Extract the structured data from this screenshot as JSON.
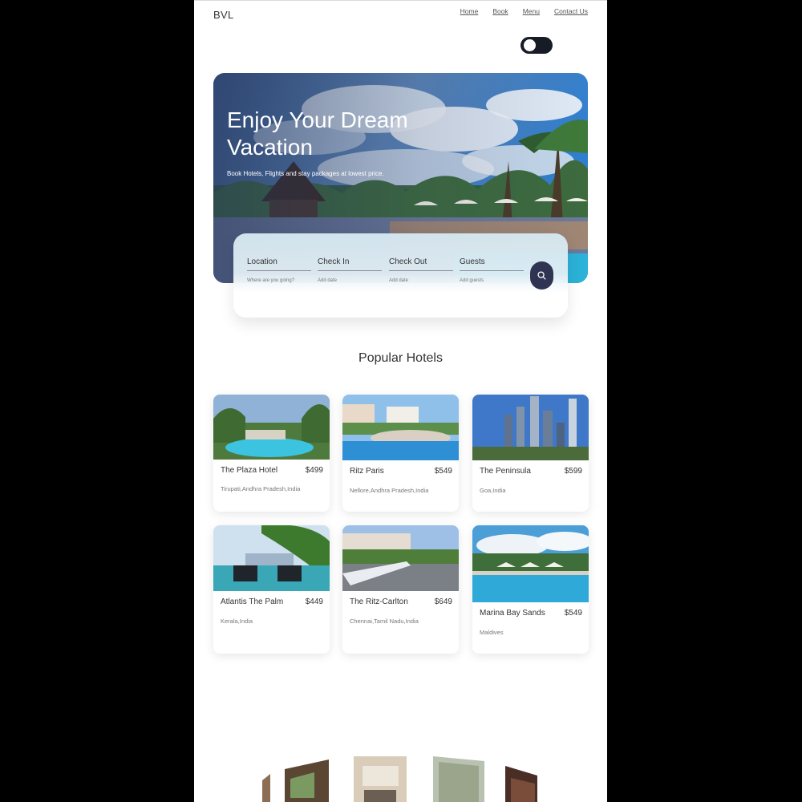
{
  "header": {
    "brand": "BVL",
    "nav": [
      "Home",
      "Book",
      "Menu",
      "Contact Us"
    ]
  },
  "theme_toggle": {
    "state": "off"
  },
  "hero": {
    "title": "Enjoy Your Dream Vacation",
    "subtitle": "Book Hotels, Flights and stay packages at lowest price."
  },
  "search": {
    "fields": [
      {
        "label": "Location",
        "placeholder": "Where are you going?"
      },
      {
        "label": "Check In",
        "placeholder": "Add date"
      },
      {
        "label": "Check Out",
        "placeholder": "Add date"
      },
      {
        "label": "Guests",
        "placeholder": "Add guests"
      }
    ],
    "button_icon": "search-icon"
  },
  "popular": {
    "title": "Popular Hotels",
    "hotels": [
      {
        "name": "The Plaza Hotel",
        "price": "$499",
        "location": "Tirupati,Andhra Pradesh,India"
      },
      {
        "name": "Ritz Paris",
        "price": "$549",
        "location": "Nellore,Andhra Pradesh,India"
      },
      {
        "name": "The Peninsula",
        "price": "$599",
        "location": "Goa,India"
      },
      {
        "name": "Atlantis The Palm",
        "price": "$449",
        "location": "Kerala,India"
      },
      {
        "name": "The Ritz-Carlton",
        "price": "$649",
        "location": "Chennai,Tamil Nadu,India"
      },
      {
        "name": "Marina Bay Sands",
        "price": "$549",
        "location": "Maldives"
      }
    ]
  },
  "colors": {
    "toggle": "#161b26",
    "search_button": "#2f3452",
    "backdrop": "#000000"
  }
}
